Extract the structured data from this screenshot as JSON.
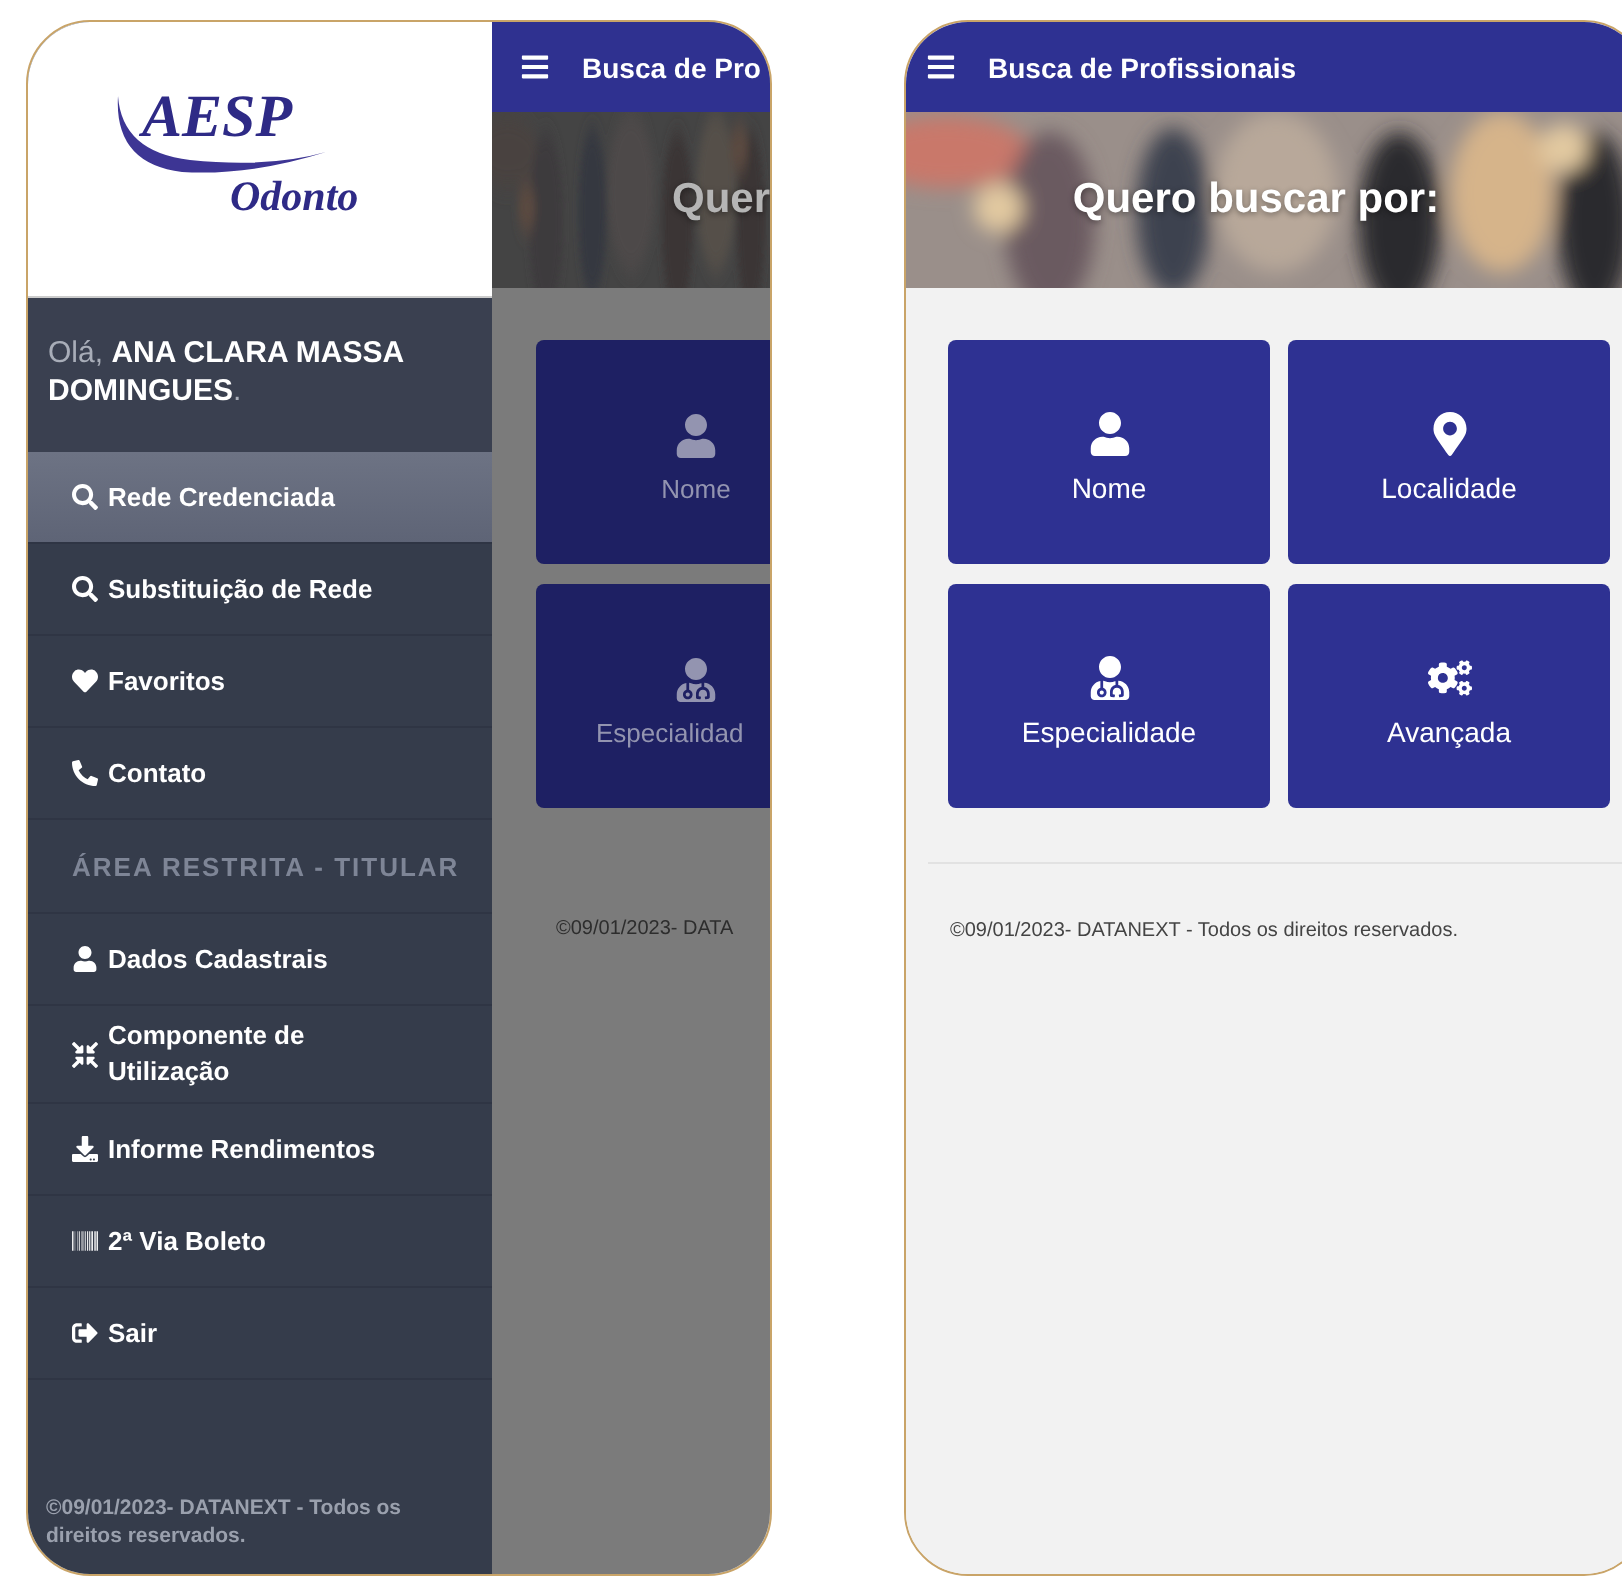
{
  "left_phone": {
    "drawer": {
      "logo": {
        "brand": "AESP",
        "subtitle": "Odonto"
      },
      "greeting": "Olá, **ANA CLARA MASSA DOMINGUES**.",
      "sections": [
        {
          "items": [
            {
              "label": "Rede Credenciada",
              "selected": true
            },
            {
              "label": "Substituição de Rede",
              "selected": false
            },
            {
              "label": "Favoritos",
              "selected": false
            },
            {
              "label": "Contato",
              "selected": false
            }
          ]
        },
        {
          "heading": "ÁREA RESTRITA - TITULAR",
          "items": [
            {
              "label": "Dados Cadastrais",
              "selected": false
            },
            {
              "label": "Componente de Utilização",
              "selected": false
            },
            {
              "label": "Informe Rendimentos",
              "selected": false
            },
            {
              "label": "2ª Via Boleto",
              "selected": false
            },
            {
              "label": "Sair",
              "selected": false
            }
          ]
        }
      ],
      "footer": "©09/01/2023- DATANEXT - Todos os direitos reservados."
    },
    "behind": {
      "title": "Busca de Pro",
      "banner": "Quer",
      "tiles": [
        "Nome",
        "Especialidad"
      ],
      "footer": "©09/01/2023- DATA"
    }
  },
  "right_phone": {
    "title": "Busca de Profissionais",
    "banner": "Quero buscar por:",
    "tiles": [
      "Nome",
      "Localidade",
      "Especialidade",
      "Avançada"
    ],
    "footer": "©09/01/2023- DATANEXT - Todos os direitos reservados."
  }
}
